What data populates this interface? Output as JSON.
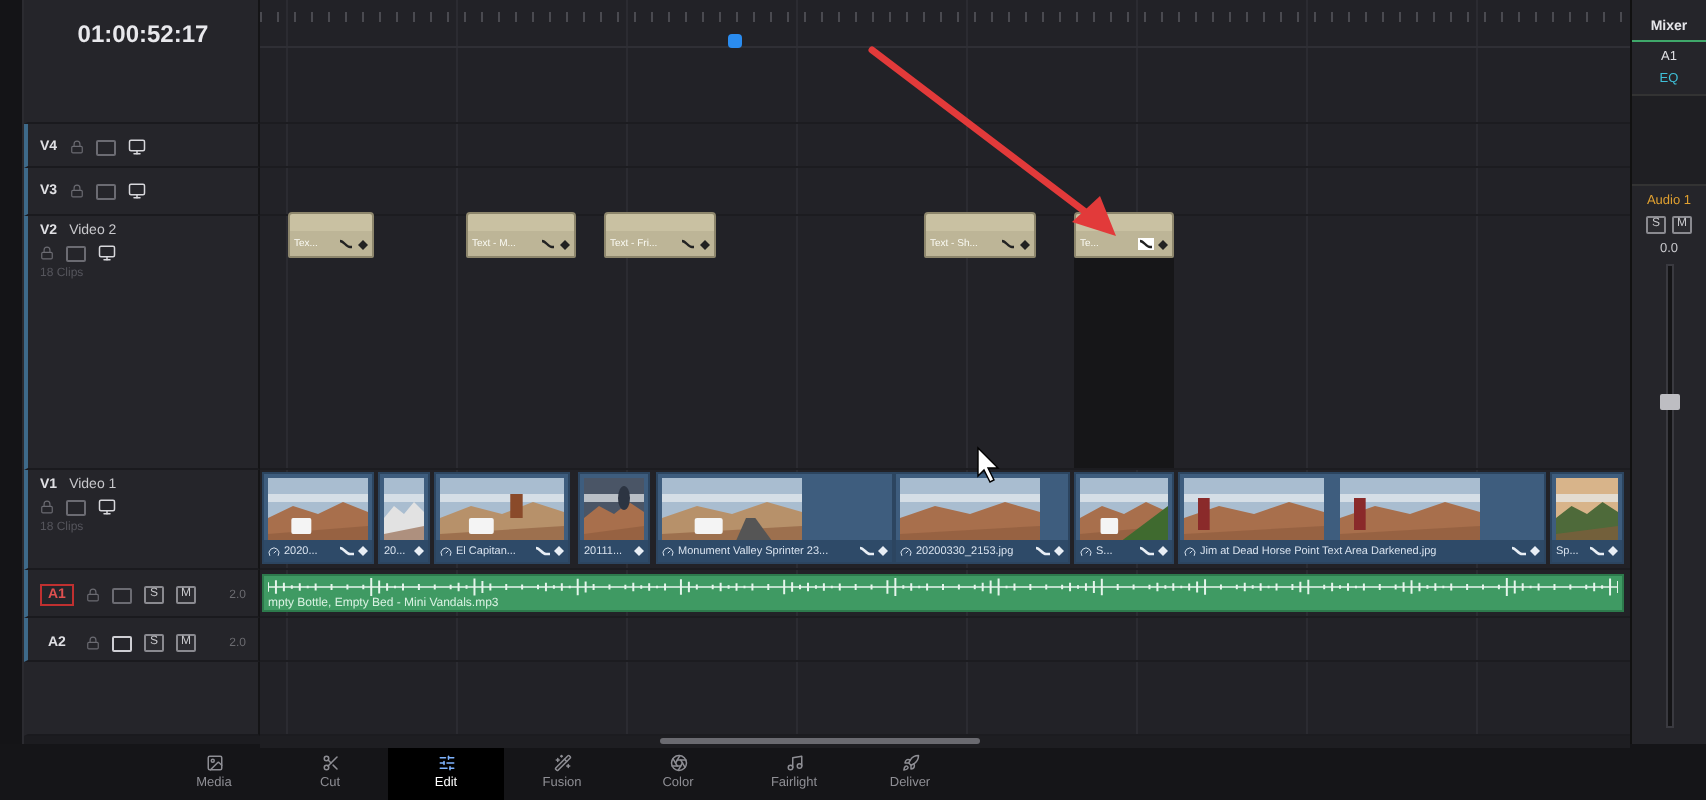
{
  "timecode": "01:00:52:17",
  "video_tracks": [
    {
      "kind": "empty",
      "label": "V4"
    },
    {
      "kind": "empty",
      "label": "V3"
    },
    {
      "kind": "titles",
      "label": "V2",
      "name": "Video 2",
      "clip_count": "18 Clips",
      "clips": [
        {
          "name": "Tex...",
          "selected": false
        },
        {
          "name": "Text - M...",
          "selected": false
        },
        {
          "name": "Text - Fri...",
          "selected": false
        },
        {
          "name": "Text - Sh...",
          "selected": false
        },
        {
          "name": "Te...",
          "selected": true
        }
      ]
    },
    {
      "kind": "video",
      "label": "V1",
      "name": "Video 1",
      "clip_count": "18 Clips",
      "clips": [
        {
          "name": "2020...",
          "speed": true,
          "curve": true
        },
        {
          "name": "20...",
          "speed": false,
          "curve": false
        },
        {
          "name": "El Capitan...",
          "speed": true,
          "curve": true
        },
        {
          "name": "20111...",
          "speed": false,
          "curve": false
        },
        {
          "name": "Monument Valley Sprinter 23...",
          "speed": true,
          "curve": true
        },
        {
          "name": "20200330_2153.jpg",
          "speed": true,
          "curve": true
        },
        {
          "name": "S...",
          "speed": true,
          "curve": true
        },
        {
          "name": "Jim at Dead Horse Point Text Area Darkened.jpg",
          "speed": true,
          "curve": true
        },
        {
          "name": "Sp...",
          "speed": false,
          "curve": true
        }
      ]
    }
  ],
  "audio_tracks": [
    {
      "label": "A1",
      "selected": true,
      "solo": "S",
      "mute": "M",
      "format": "2.0",
      "clip": {
        "name": "mpty Bottle, Empty Bed - Mini Vandals.mp3"
      }
    },
    {
      "label": "A2",
      "selected": false,
      "solo": "S",
      "mute": "M",
      "format": "2.0"
    }
  ],
  "mixer": {
    "title": "Mixer",
    "channel": "A1",
    "eq": "EQ",
    "track_name": "Audio 1",
    "solo": "S",
    "mute": "M",
    "reading": "0.0",
    "level": 0.72
  },
  "pages": [
    {
      "label": "Media",
      "selected": false
    },
    {
      "label": "Cut",
      "selected": false
    },
    {
      "label": "Edit",
      "selected": true
    },
    {
      "label": "Fusion",
      "selected": false
    },
    {
      "label": "Color",
      "selected": false
    },
    {
      "label": "Fairlight",
      "selected": false
    },
    {
      "label": "Deliver",
      "selected": false
    }
  ]
}
